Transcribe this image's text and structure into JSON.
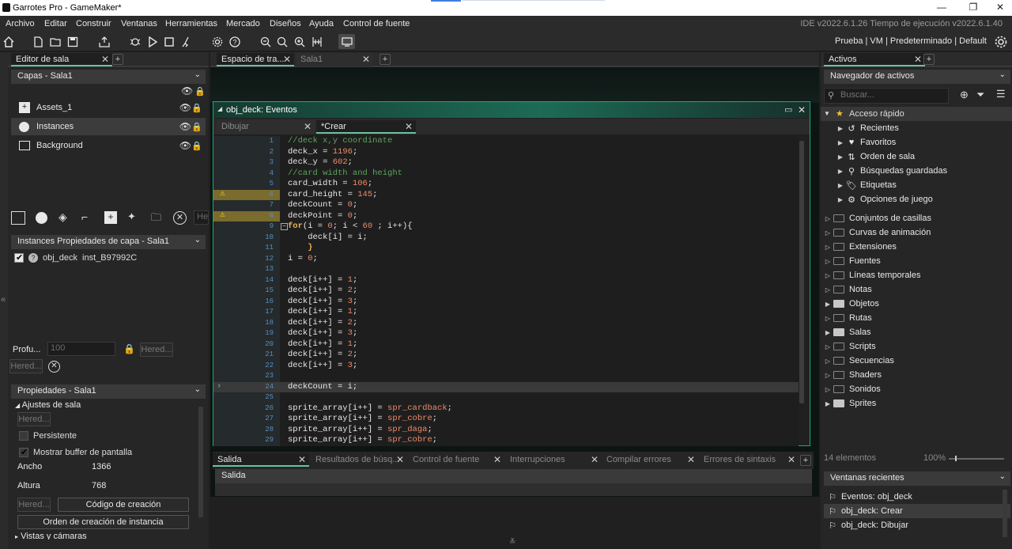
{
  "window": {
    "title": "Garrotes Pro - GameMaker*"
  },
  "menu": [
    "Archivo",
    "Editar",
    "Construir",
    "Ventanas",
    "Herramientas",
    "Mercado",
    "Diseños",
    "Ayuda",
    "Control de fuente"
  ],
  "version": "IDE v2022.6.1.26  Tiempo de ejecución v2022.6.1.40",
  "target": "Prueba | VM | Predeterminado | Default",
  "room_editor": {
    "tab": "Editor de sala",
    "layers_dropdown": "Capas - Sala1",
    "layers": [
      {
        "name": "Assets_1"
      },
      {
        "name": "Instances"
      },
      {
        "name": "Background"
      }
    ],
    "depth_label": "Profu...",
    "depth_value": "100",
    "inherit_label": "Hered...",
    "inherit2_label": "Hered...",
    "search_partial": "He",
    "instances_dropdown": "Instances Propiedades de capa - Sala1",
    "instance": {
      "object": "obj_deck",
      "id": "inst_B97992C"
    },
    "props_dropdown": "Propiedades - Sala1",
    "room_settings": "Ajustes de sala",
    "room_inherit": "Hered...",
    "persistent": "Persistente",
    "show_buffer": "Mostrar buffer de pantalla",
    "width_label": "Ancho",
    "width_value": "1366",
    "height_label": "Altura",
    "height_value": "768",
    "creation_code_inherit": "Hered...",
    "creation_code": "Código de creación",
    "instance_order": "Orden de creación de instancia",
    "views": "Vistas y cámaras"
  },
  "workspace": {
    "tabs": [
      "Espacio de tra...",
      "Sala1"
    ]
  },
  "object_window": {
    "title": "obj_deck: Eventos",
    "tabs": [
      "Dibujar",
      "*Crear"
    ],
    "lines": [
      {
        "n": "1",
        "s": [
          [
            "cm",
            "//deck x,y coordinate"
          ]
        ]
      },
      {
        "n": "2",
        "s": [
          [
            "var",
            "deck_x = "
          ],
          [
            "num",
            "1196"
          ],
          [
            "var",
            ";"
          ]
        ]
      },
      {
        "n": "3",
        "s": [
          [
            "var",
            "deck_y = "
          ],
          [
            "num",
            "602"
          ],
          [
            "var",
            ";"
          ]
        ]
      },
      {
        "n": "4",
        "s": [
          [
            "cm",
            "//card width and height"
          ]
        ]
      },
      {
        "n": "5",
        "s": [
          [
            "var",
            "card_width = "
          ],
          [
            "num",
            "106"
          ],
          [
            "var",
            ";"
          ]
        ]
      },
      {
        "n": "6",
        "s": [
          [
            "var",
            "card_height = "
          ],
          [
            "num",
            "145"
          ],
          [
            "var",
            ";"
          ]
        ],
        "warn": true
      },
      {
        "n": "7",
        "s": [
          [
            "var",
            "deckCount = "
          ],
          [
            "num",
            "0"
          ],
          [
            "var",
            ";"
          ]
        ]
      },
      {
        "n": "8",
        "s": [
          [
            "var",
            "deckPoint = "
          ],
          [
            "num",
            "0"
          ],
          [
            "var",
            ";"
          ]
        ],
        "warn": true
      },
      {
        "n": "9",
        "s": [
          [
            "kw",
            "for"
          ],
          [
            "var",
            "(i = "
          ],
          [
            "num",
            "0"
          ],
          [
            "var",
            "; i < "
          ],
          [
            "num",
            "60"
          ],
          [
            "var",
            " ; i++){"
          ]
        ]
      },
      {
        "n": "10",
        "s": [
          [
            "var",
            "    deck[i] = i;"
          ]
        ]
      },
      {
        "n": "11",
        "s": [
          [
            "var",
            "    "
          ],
          [
            "kw",
            "}"
          ]
        ]
      },
      {
        "n": "12",
        "s": [
          [
            "var",
            "i = "
          ],
          [
            "num",
            "0"
          ],
          [
            "var",
            ";"
          ]
        ]
      },
      {
        "n": "13",
        "s": [
          [
            "var",
            ""
          ]
        ]
      },
      {
        "n": "14",
        "s": [
          [
            "var",
            "deck[i++] = "
          ],
          [
            "num",
            "1"
          ],
          [
            "var",
            ";"
          ]
        ]
      },
      {
        "n": "15",
        "s": [
          [
            "var",
            "deck[i++] = "
          ],
          [
            "num",
            "2"
          ],
          [
            "var",
            ";"
          ]
        ]
      },
      {
        "n": "16",
        "s": [
          [
            "var",
            "deck[i++] = "
          ],
          [
            "num",
            "3"
          ],
          [
            "var",
            ";"
          ]
        ]
      },
      {
        "n": "17",
        "s": [
          [
            "var",
            "deck[i++] = "
          ],
          [
            "num",
            "1"
          ],
          [
            "var",
            ";"
          ]
        ]
      },
      {
        "n": "18",
        "s": [
          [
            "var",
            "deck[i++] = "
          ],
          [
            "num",
            "2"
          ],
          [
            "var",
            ";"
          ]
        ]
      },
      {
        "n": "19",
        "s": [
          [
            "var",
            "deck[i++] = "
          ],
          [
            "num",
            "3"
          ],
          [
            "var",
            ";"
          ]
        ]
      },
      {
        "n": "20",
        "s": [
          [
            "var",
            "deck[i++] = "
          ],
          [
            "num",
            "1"
          ],
          [
            "var",
            ";"
          ]
        ]
      },
      {
        "n": "21",
        "s": [
          [
            "var",
            "deck[i++] = "
          ],
          [
            "num",
            "2"
          ],
          [
            "var",
            ";"
          ]
        ]
      },
      {
        "n": "22",
        "s": [
          [
            "var",
            "deck[i++] = "
          ],
          [
            "num",
            "3"
          ],
          [
            "var",
            ";"
          ]
        ]
      },
      {
        "n": "23",
        "s": [
          [
            "var",
            ""
          ]
        ]
      },
      {
        "n": "24",
        "s": [
          [
            "var",
            "deckCount = i;"
          ]
        ],
        "current": true
      },
      {
        "n": "25",
        "s": [
          [
            "var",
            ""
          ]
        ]
      },
      {
        "n": "26",
        "s": [
          [
            "var",
            "sprite_array[i++] = "
          ],
          [
            "res",
            "spr_cardback"
          ],
          [
            "var",
            ";"
          ]
        ]
      },
      {
        "n": "27",
        "s": [
          [
            "var",
            "sprite_array[i++] = "
          ],
          [
            "res",
            "spr_cobre"
          ],
          [
            "var",
            ";"
          ]
        ]
      },
      {
        "n": "28",
        "s": [
          [
            "var",
            "sprite_array[i++] = "
          ],
          [
            "res",
            "spr_daga"
          ],
          [
            "var",
            ";"
          ]
        ]
      },
      {
        "n": "29",
        "s": [
          [
            "var",
            "sprite_array[i++] = "
          ],
          [
            "res",
            "spr_cobre"
          ],
          [
            "var",
            ";"
          ]
        ]
      }
    ]
  },
  "output": {
    "tabs": [
      "Salida",
      "Resultados de búsq...",
      "Control de fuente",
      "Interrupciones",
      "Compilar errores",
      "Errores de sintaxis"
    ],
    "header": "Salida"
  },
  "assets": {
    "tab": "Activos",
    "dropdown": "Navegador de activos",
    "search_placeholder": "Buscar...",
    "quick_access": "Acceso rápido",
    "quick": [
      "Recientes",
      "Favoritos",
      "Orden de sala",
      "Búsquedas guardadas",
      "Etiquetas",
      "Opciones de juego"
    ],
    "folders": [
      "Conjuntos de casillas",
      "Curvas de animación",
      "Extensiones",
      "Fuentes",
      "Líneas temporales",
      "Notas",
      "Objetos",
      "Rutas",
      "Salas",
      "Scripts",
      "Secuencias",
      "Shaders",
      "Sonidos",
      "Sprites"
    ],
    "count": "14 elementos",
    "zoom": "100%",
    "recent_dropdown": "Ventanas recientes",
    "recent": [
      "Eventos: obj_deck",
      "obj_deck: Crear",
      "obj_deck: Dibujar"
    ]
  }
}
